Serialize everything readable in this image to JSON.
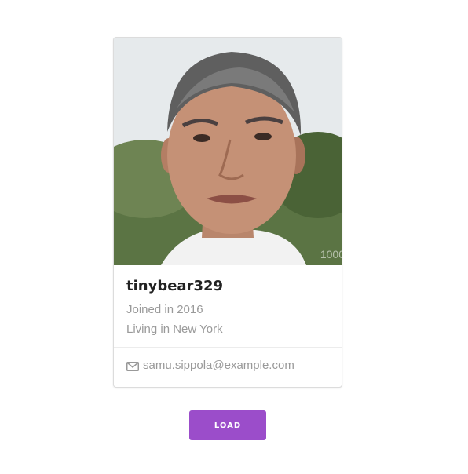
{
  "card": {
    "username": "tinybear329",
    "joined": "Joined in 2016",
    "location": "Living in New York",
    "email": "samu.sippola@example.com",
    "photo_watermark": "1000",
    "email_icon": "envelope-icon"
  },
  "actions": {
    "load_label": "LOAD"
  },
  "colors": {
    "button_bg": "#9b4dca",
    "muted_text": "#999999",
    "name_text": "#222222"
  }
}
